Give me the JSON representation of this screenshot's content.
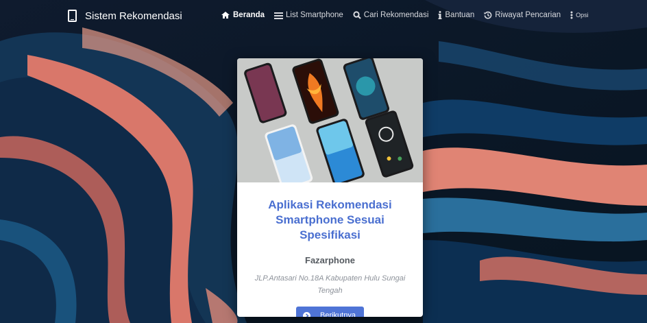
{
  "navbar": {
    "brand": "Sistem Rekomendasi",
    "items": [
      {
        "label": "Beranda",
        "icon": "home-icon",
        "active": true
      },
      {
        "label": "List Smartphone",
        "icon": "list-icon"
      },
      {
        "label": "Cari Rekomendasi",
        "icon": "search-icon"
      },
      {
        "label": "Bantuan",
        "icon": "info-icon"
      },
      {
        "label": "Riwayat Pencarian",
        "icon": "history-icon"
      },
      {
        "label": "Opsi",
        "icon": "more-vertical-icon"
      }
    ]
  },
  "card": {
    "title": "Aplikasi Rekomendasi Smartphone Sesuai Spesifikasi",
    "subtitle": "Fazarphone",
    "address": "JLP.Antasari No.18A Kabupaten Hulu Sungai Tengah",
    "button_label": "Berikutnya"
  },
  "colors": {
    "accent": "#4f74d6",
    "title": "#4a6fd0"
  }
}
